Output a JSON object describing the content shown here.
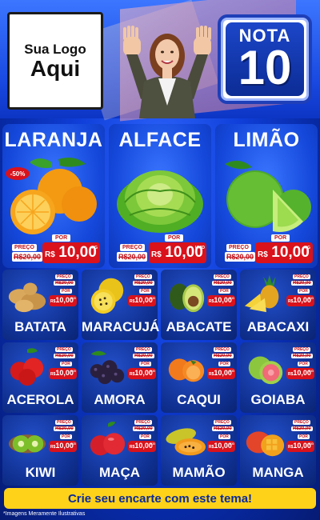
{
  "logo": {
    "line1": "Sua Logo",
    "line2": "Aqui"
  },
  "badge": {
    "line1": "NOTA",
    "line2": "10"
  },
  "featured": [
    {
      "name": "LARANJA",
      "preco_label": "PREÇO",
      "old": "R$20,00",
      "por_label": "POR",
      "currency": "R$",
      "price": "10,00",
      "unit": "KG",
      "icon": "orange-icon"
    },
    {
      "name": "ALFACE",
      "preco_label": "PREÇO",
      "old": "R$20,00",
      "por_label": "POR",
      "currency": "R$",
      "price": "10,00",
      "unit": "UNID",
      "icon": "lettuce-icon"
    },
    {
      "name": "LIMÃO",
      "preco_label": "PREÇO",
      "old": "R$20,00",
      "por_label": "POR",
      "currency": "R$",
      "price": "10,00",
      "unit": "KG",
      "icon": "lime-icon"
    }
  ],
  "products": [
    {
      "name": "BATATA",
      "icon": "potato-icon"
    },
    {
      "name": "MARACUJÁ",
      "icon": "passion-fruit-icon"
    },
    {
      "name": "ABACATE",
      "icon": "avocado-icon"
    },
    {
      "name": "ABACAXI",
      "icon": "pineapple-icon"
    },
    {
      "name": "ACEROLA",
      "icon": "acerola-icon"
    },
    {
      "name": "AMORA",
      "icon": "blackberry-icon"
    },
    {
      "name": "CAQUI",
      "icon": "persimmon-icon"
    },
    {
      "name": "GOIABA",
      "icon": "guava-icon"
    },
    {
      "name": "KIWI",
      "icon": "kiwi-icon"
    },
    {
      "name": "MAÇA",
      "icon": "apple-icon"
    },
    {
      "name": "MAMÃO",
      "icon": "papaya-icon"
    },
    {
      "name": "MANGA",
      "icon": "mango-icon"
    }
  ],
  "small_price": {
    "preco_label": "PREÇO",
    "old": "R$20,00",
    "por_label": "POR",
    "currency": "R$",
    "price": "10,00",
    "unit": "KG"
  },
  "cta": "Crie seu encarte com este tema!",
  "footnote": "*Imagens Meramente Ilustrativas",
  "colors": {
    "primary": "#1447da",
    "accent": "#ffd21a",
    "price_red": "#d9121b"
  }
}
